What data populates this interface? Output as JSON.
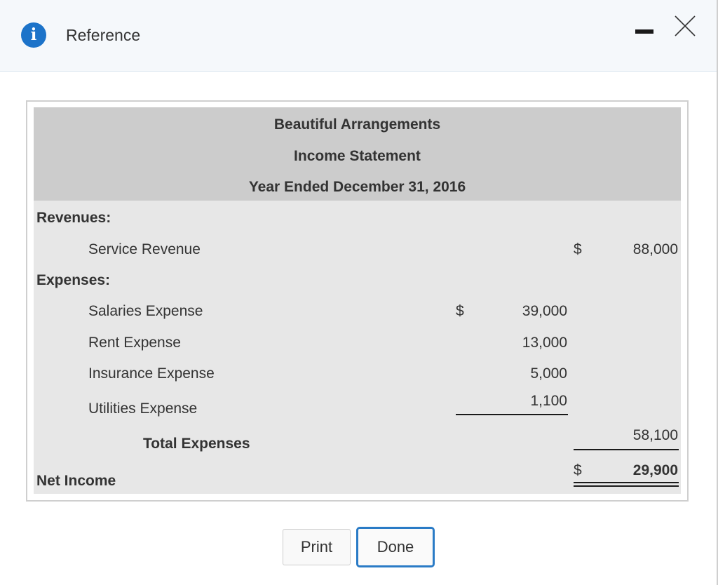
{
  "dialog": {
    "title": "Reference",
    "info_icon_glyph": "i",
    "accent_color": "#1c73c9"
  },
  "statement": {
    "company": "Beautiful Arrangements",
    "name": "Income Statement",
    "period": "Year Ended December 31, 2016",
    "revenues_label": "Revenues:",
    "revenue_items": [
      {
        "label": "Service Revenue",
        "currency": "$",
        "amount": "88,000"
      }
    ],
    "expenses_label": "Expenses:",
    "expense_items": [
      {
        "label": "Salaries Expense",
        "currency": "$",
        "amount": "39,000"
      },
      {
        "label": "Rent Expense",
        "currency": "",
        "amount": "13,000"
      },
      {
        "label": "Insurance Expense",
        "currency": "",
        "amount": "5,000"
      },
      {
        "label": "Utilities Expense",
        "currency": "",
        "amount": "1,100"
      }
    ],
    "total_expenses_label": "Total Expenses",
    "total_expenses_amount": "58,100",
    "net_income_label": "Net Income",
    "net_income_currency": "$",
    "net_income_amount": "29,900"
  },
  "buttons": {
    "print_label": "Print",
    "done_label": "Done"
  }
}
